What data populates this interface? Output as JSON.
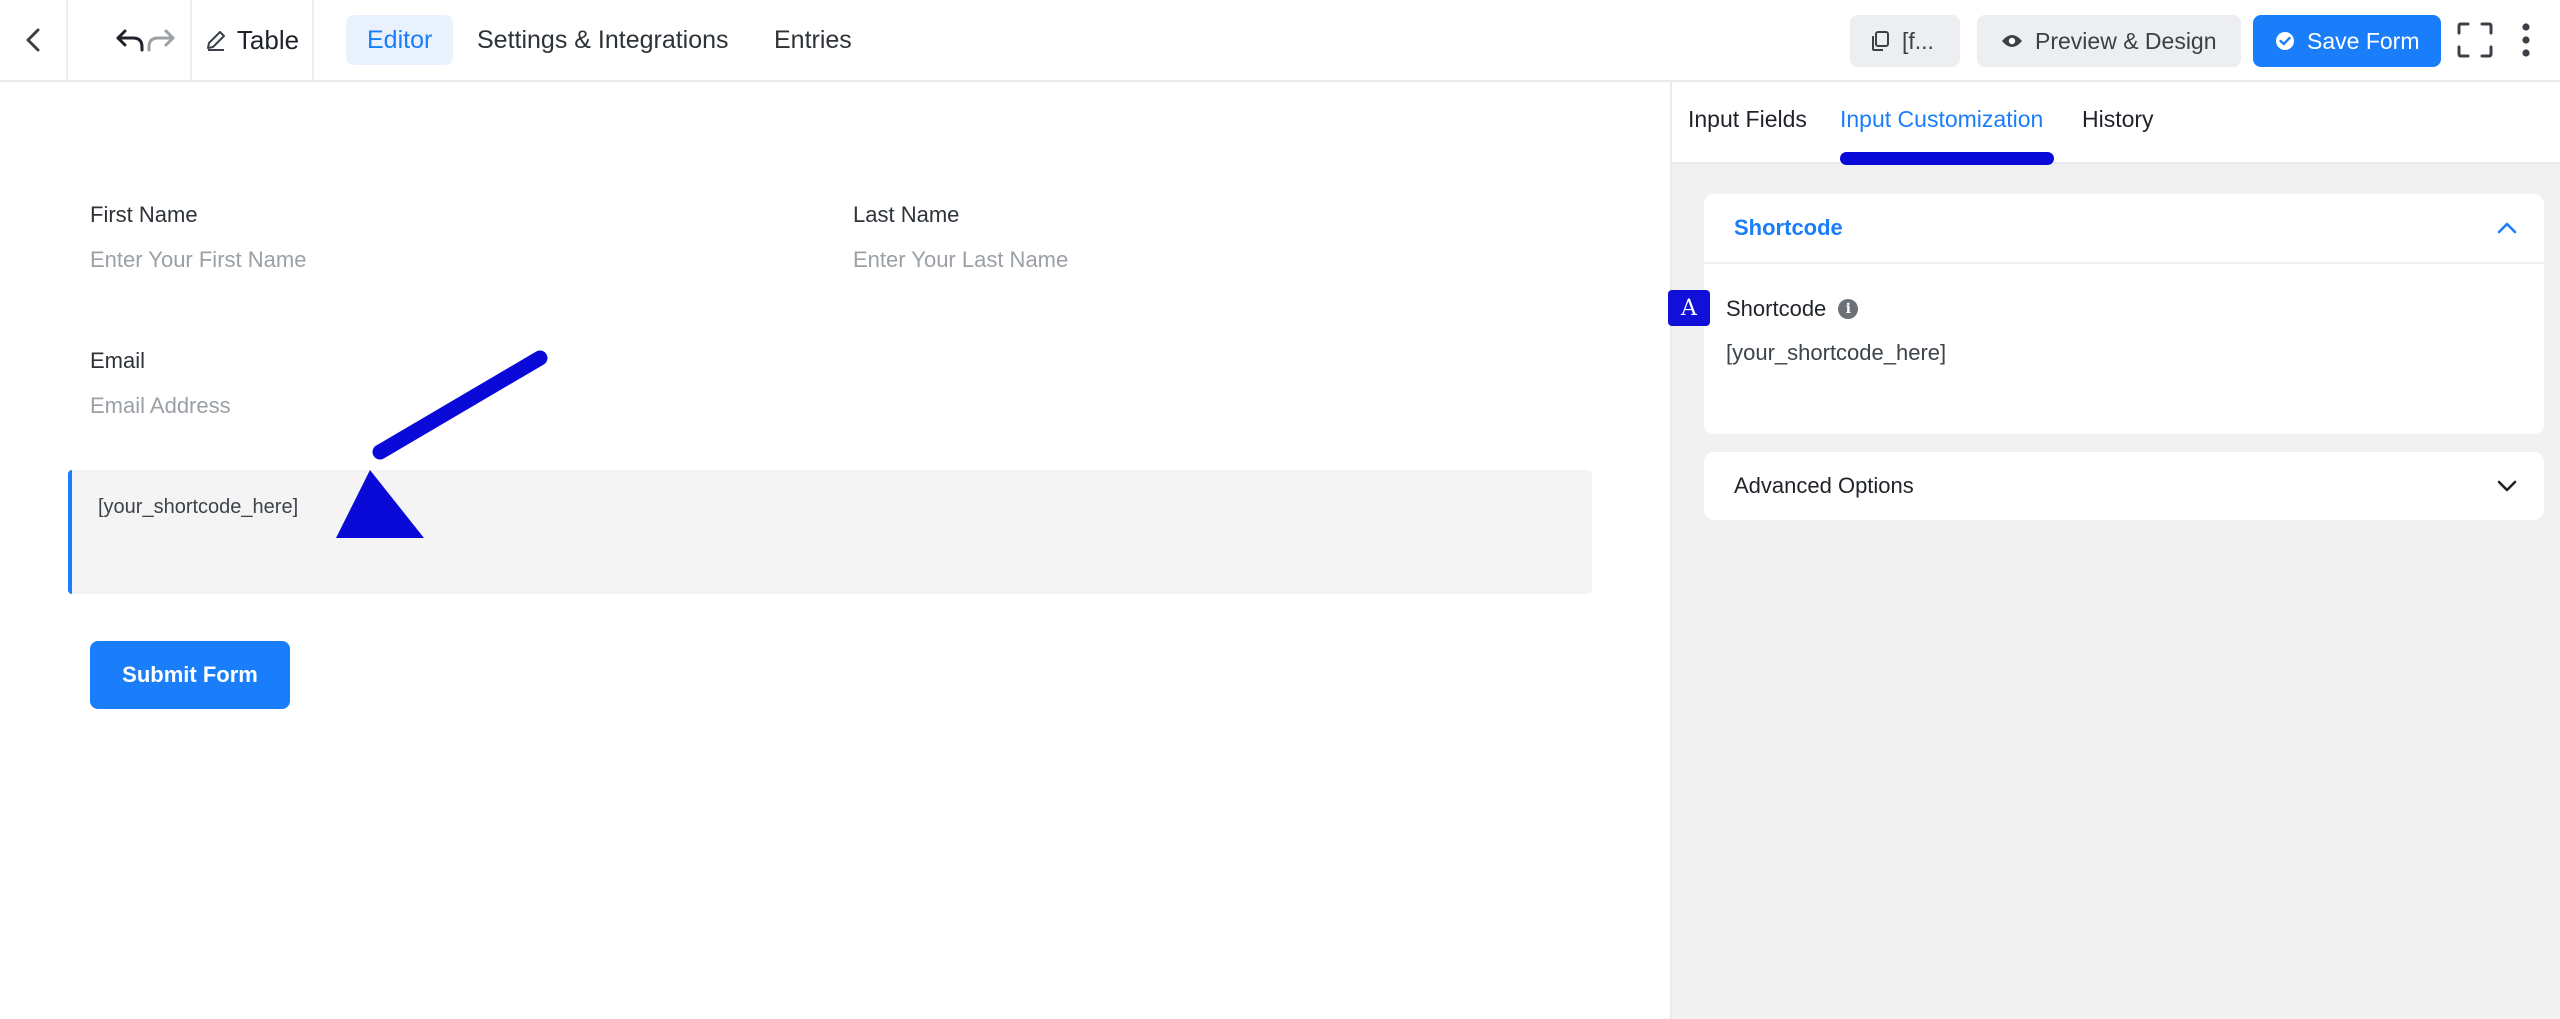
{
  "topbar": {
    "back_icon": "chevron-left-icon",
    "undo_icon": "undo-icon",
    "redo_icon": "redo-icon",
    "edit_icon": "pencil-icon",
    "form_title": "Table",
    "nav_tabs": [
      {
        "label": "Editor",
        "active": true
      },
      {
        "label": "Settings & Integrations",
        "active": false
      },
      {
        "label": "Entries",
        "active": false
      }
    ],
    "shortcode_copy_label": "[f...",
    "preview_label": "Preview & Design",
    "save_label": "Save Form",
    "fullscreen_icon": "fullscreen-icon",
    "more_icon": "vertical-dots-icon"
  },
  "form": {
    "first_name_label": "First Name",
    "first_name_placeholder": "Enter Your First Name",
    "last_name_label": "Last Name",
    "last_name_placeholder": "Enter Your Last Name",
    "email_label": "Email",
    "email_placeholder": "Email Address",
    "shortcode_text": "[your_shortcode_here]",
    "submit_label": "Submit Form"
  },
  "sidebar": {
    "tabs": [
      {
        "label": "Input Fields",
        "active": false
      },
      {
        "label": "Input Customization",
        "active": true
      },
      {
        "label": "History",
        "active": false
      }
    ],
    "shortcode_section": {
      "title": "Shortcode",
      "field_label": "Shortcode",
      "field_value": "[your_shortcode_here]"
    },
    "advanced_section": {
      "title": "Advanced Options"
    }
  },
  "annotations": {
    "badge_letter": "A"
  },
  "colors": {
    "accent": "#1a7efb",
    "annotation": "#0a0ad8"
  }
}
